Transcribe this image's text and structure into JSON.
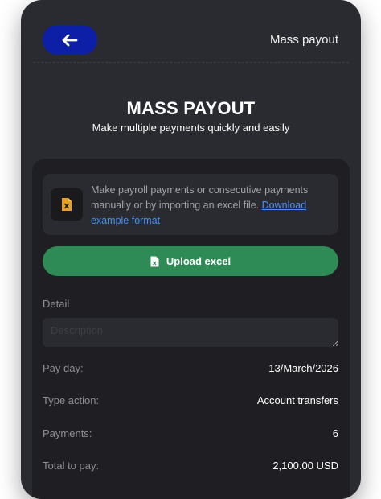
{
  "header": {
    "title": "Mass payout"
  },
  "hero": {
    "title": "MASS PAYOUT",
    "subtitle": "Make multiple payments quickly and easily"
  },
  "info": {
    "text": "Make payroll payments or consecutive payments manually or by importing an excel file.",
    "link_label": "Download example format"
  },
  "upload": {
    "label": "Upload excel"
  },
  "detail": {
    "label": "Detail",
    "placeholder": "Description",
    "value": ""
  },
  "summary": [
    {
      "key": "Pay day:",
      "value": "13/March/2026"
    },
    {
      "key": "Type action:",
      "value": "Account transfers"
    },
    {
      "key": "Payments:",
      "value": "6"
    },
    {
      "key": "Total to pay:",
      "value": "2,100.00 USD"
    }
  ],
  "colors": {
    "background": "#2a2b30",
    "card": "#1f1f23",
    "accent_blue": "#0c1fa6",
    "upload_green": "#2f8b55",
    "link": "#4c8df6",
    "excel_icon": "#e8a020"
  },
  "icons": {
    "back": "arrow-left-icon",
    "excel": "excel-file-icon",
    "upload": "file-icon"
  }
}
